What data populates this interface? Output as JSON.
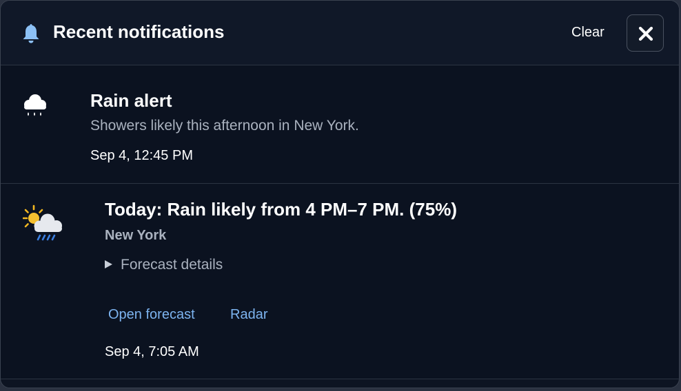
{
  "header": {
    "title": "Recent notifications",
    "clear_label": "Clear",
    "bell_icon": "bell-icon",
    "close_icon": "close-icon"
  },
  "notifications": [
    {
      "icon": "cloud-rain-icon",
      "title": "Rain alert",
      "message": "Showers likely this afternoon in New York.",
      "time": "Sep 4, 12:45 PM"
    },
    {
      "icon": "sun-behind-rain-cloud-icon",
      "title": "Today: Rain likely from 4 PM–7 PM. (75%)",
      "location": "New York",
      "details_label": "Forecast details",
      "actions": [
        "Open forecast",
        "Radar"
      ],
      "time": "Sep 4, 7:05 AM"
    }
  ],
  "colors": {
    "accent": "#7db4f0",
    "bell": "#8cc0f5",
    "background": "#0b1220"
  }
}
